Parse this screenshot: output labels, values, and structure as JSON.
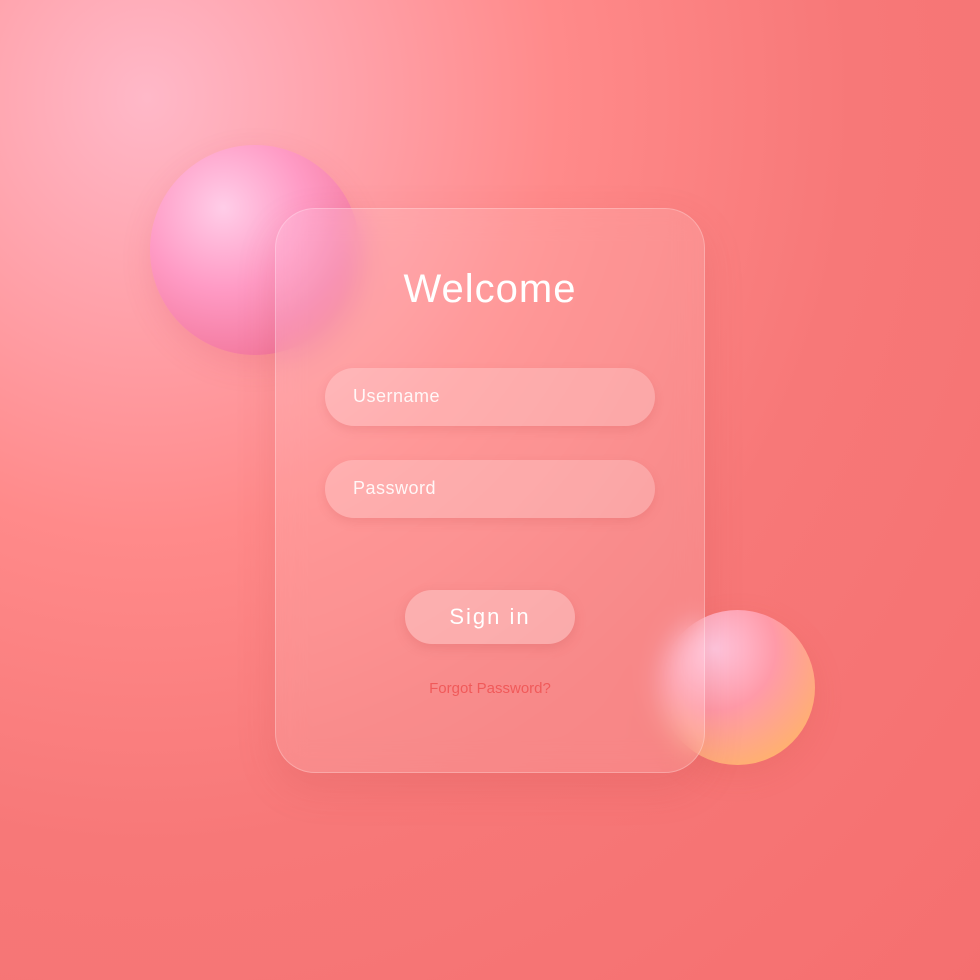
{
  "login": {
    "title": "Welcome",
    "username_placeholder": "Username",
    "password_placeholder": "Password",
    "signin_label": "Sign in",
    "forgot_label": "Forgot Password?"
  }
}
